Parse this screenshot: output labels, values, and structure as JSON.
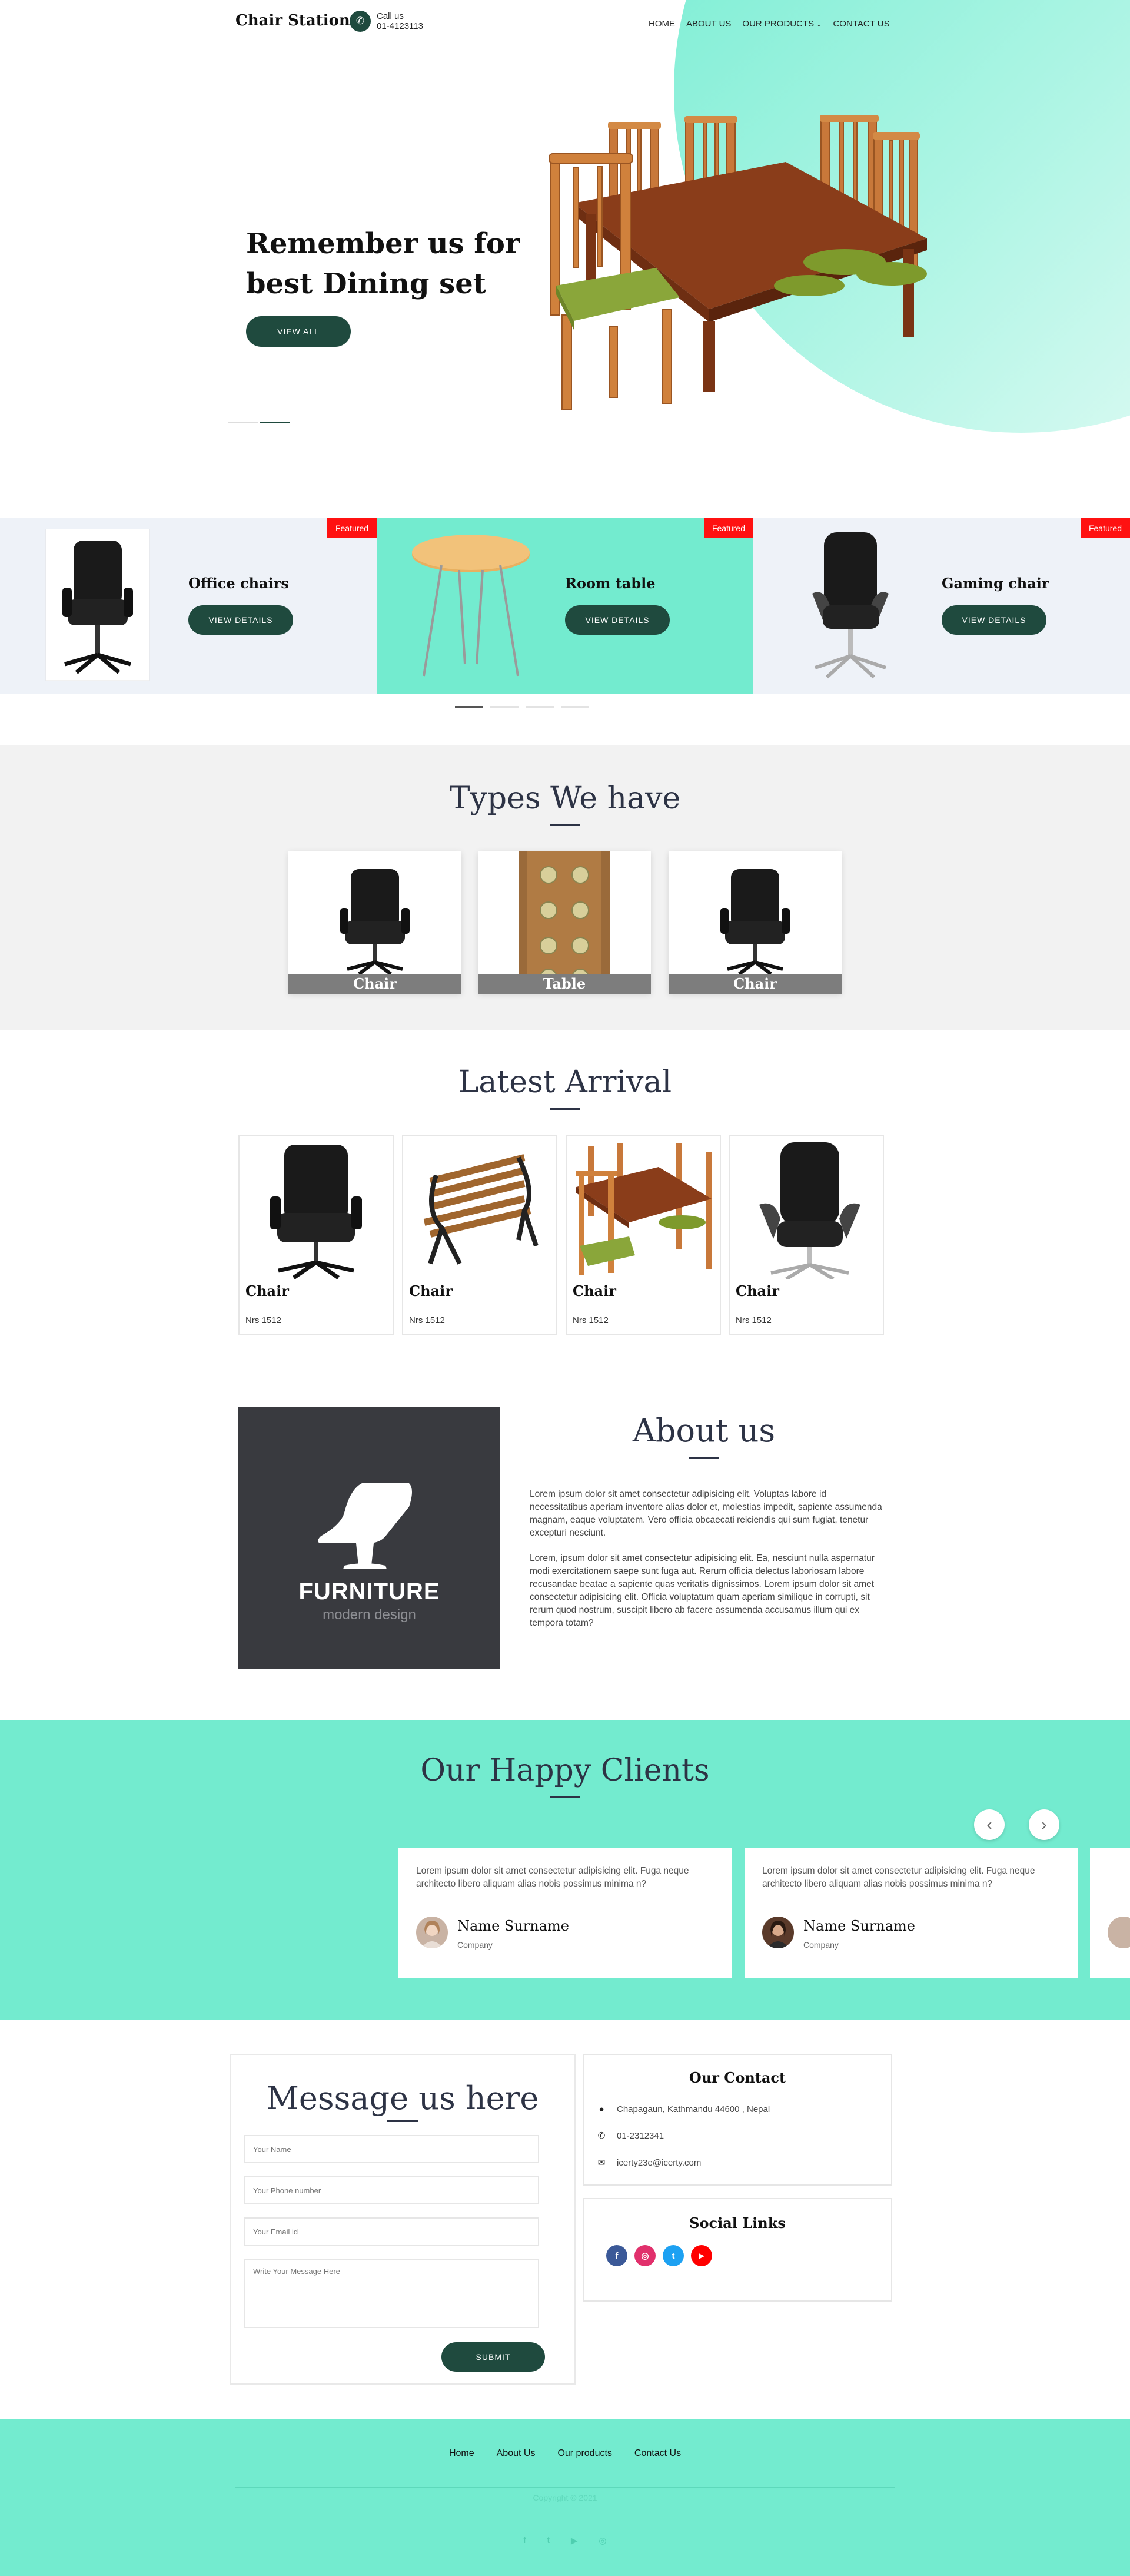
{
  "header": {
    "brand": "Chair Station",
    "call_label": "Call us",
    "call_number": "01-4123113",
    "nav": [
      "HOME",
      "ABOUT US",
      "OUR PRODUCTS",
      "CONTACT US"
    ]
  },
  "hero": {
    "title": "Remember us for best Dining set",
    "button": "VIEW ALL"
  },
  "featured": [
    {
      "badge": "Featured",
      "name": "Office chairs",
      "button": "VIEW DETAILS"
    },
    {
      "badge": "Featured",
      "name": "Room table",
      "button": "VIEW DETAILS"
    },
    {
      "badge": "Featured",
      "name": "Gaming chair",
      "button": "VIEW DETAILS"
    }
  ],
  "types": {
    "title": "Types We have",
    "items": [
      {
        "label": "Chair"
      },
      {
        "label": "Table"
      },
      {
        "label": "Chair"
      }
    ]
  },
  "latest": {
    "title": "Latest Arrival",
    "items": [
      {
        "name": "Chair",
        "currency": "Nrs",
        "price": "1512"
      },
      {
        "name": "Chair",
        "currency": "Nrs",
        "price": "1512"
      },
      {
        "name": "Chair",
        "currency": "Nrs",
        "price": "1512"
      },
      {
        "name": "Chair",
        "currency": "Nrs",
        "price": "1512"
      }
    ]
  },
  "about": {
    "title": "About us",
    "logo_word": "FURNITURE",
    "logo_sub": "modern design",
    "p1": "Lorem ipsum dolor sit amet consectetur adipisicing elit. Voluptas labore id necessitatibus aperiam inventore alias dolor et, molestias impedit, sapiente assumenda magnam, eaque voluptatem. Vero officia obcaecati reiciendis qui sum fugiat, tenetur excepturi nesciunt.",
    "p2": "Lorem, ipsum dolor sit amet consectetur adipisicing elit. Ea, nesciunt nulla aspernatur modi exercitationem saepe sunt fuga aut. Rerum officia delectus laboriosam labore recusandae beatae a sapiente quas veritatis dignissimos. Lorem ipsum dolor sit amet consectetur adipisicing elit. Officia voluptatum quam aperiam similique in corrupti, sit rerum quod nostrum, suscipit libero ab facere assumenda accusamus illum qui ex tempora totam?"
  },
  "clients": {
    "title": "Our Happy Clients",
    "testimonials": [
      {
        "text": "Lorem ipsum dolor sit amet consectetur adipisicing elit. Fuga neque architecto libero aliquam alias nobis possimus minima n?",
        "name": "Name Surname",
        "company": "Company"
      },
      {
        "text": "Lorem ipsum dolor sit amet consectetur adipisicing elit. Fuga neque architecto libero aliquam alias nobis possimus minima n?",
        "name": "Name Surname",
        "company": "Company"
      }
    ]
  },
  "contact_form": {
    "title": "Message us here",
    "name_placeholder": "Your Name",
    "phone_placeholder": "Your Phone number",
    "email_placeholder": "Your Email id",
    "message_placeholder": "Write Your Message Here",
    "submit": "SUBMIT"
  },
  "our_contact": {
    "title": "Our Contact",
    "address": "Chapagaun, Kathmandu 44600 , Nepal",
    "phone": "01-2312341",
    "email": "icerty23e@icerty.com"
  },
  "social": {
    "title": "Social Links",
    "links": [
      {
        "icon": "facebook-icon",
        "glyph": "f",
        "color": "#3b5998"
      },
      {
        "icon": "instagram-icon",
        "glyph": "◎",
        "color": "#e1306c"
      },
      {
        "icon": "twitter-icon",
        "glyph": "t",
        "color": "#1da1f2"
      },
      {
        "icon": "youtube-icon",
        "glyph": "▶",
        "color": "#ff0000"
      }
    ]
  },
  "footer": {
    "nav": [
      "Home",
      "About Us",
      "Our products",
      "Contact Us"
    ],
    "copyright": "Copyright © 2021",
    "icons": [
      "f",
      "t",
      "▶",
      "◎"
    ]
  },
  "colors": {
    "accent": "#73ebcf",
    "dark_green": "#1f4a3e",
    "featured_red": "#ff1111",
    "title_navy": "#2d3345"
  }
}
